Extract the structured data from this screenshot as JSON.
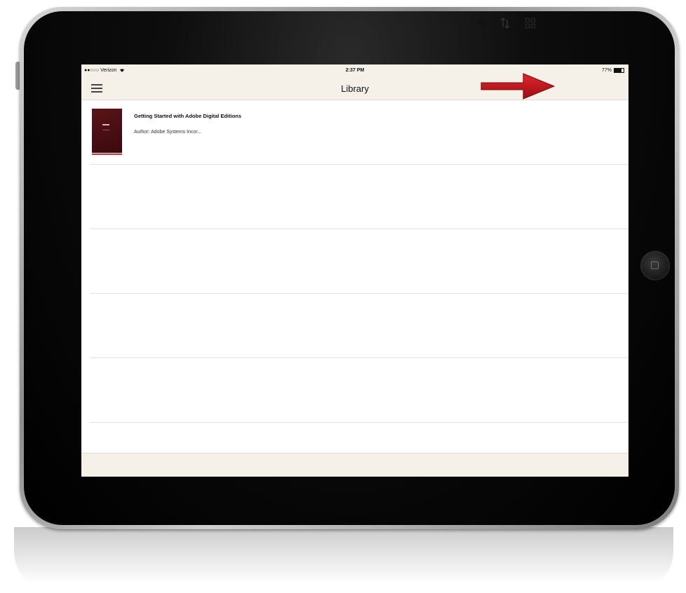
{
  "status_bar": {
    "carrier": "●●○○○ Verizon",
    "wifi_icon": "wifi-icon",
    "time": "2:37 PM",
    "battery_percent": "77%",
    "battery_level": 0.77
  },
  "nav": {
    "title": "Library",
    "menu_icon": "hamburger-menu-icon",
    "gear_icon": "gear-icon",
    "sort_icon": "sort-icon",
    "grid_icon": "grid-view-icon"
  },
  "library": {
    "items": [
      {
        "title": "Getting Started with Adobe Digital Editions",
        "author": "Author: Adobe Systems Incor...",
        "cover_color": "#4a0f14"
      }
    ],
    "empty_rows": 4
  },
  "colors": {
    "bar_background": "#f5f1e9",
    "annotation_arrow": "#c0161c"
  }
}
